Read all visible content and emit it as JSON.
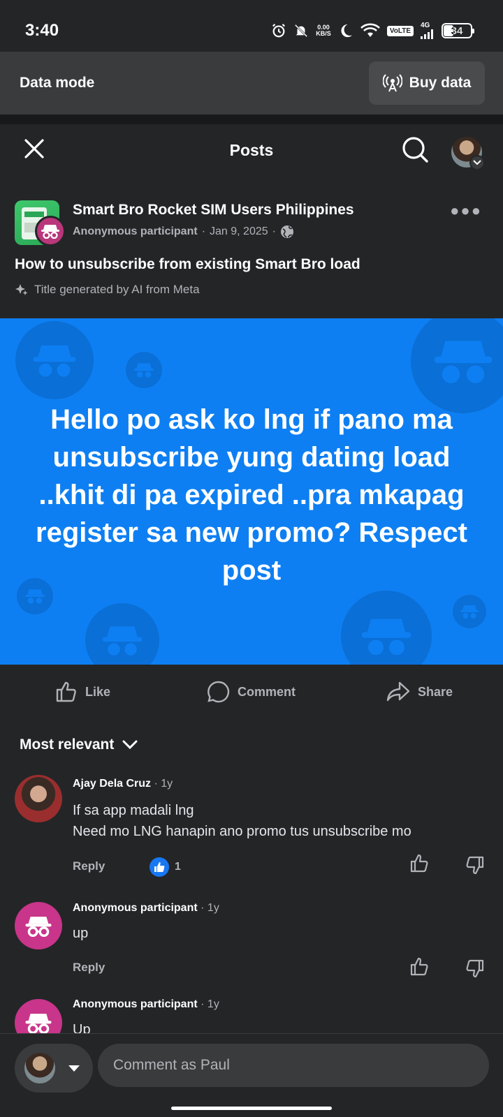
{
  "status_bar": {
    "time": "3:40",
    "net_speed_value": "0.00",
    "net_speed_unit": "KB/S",
    "volte": "VoLTE",
    "signal": "4G",
    "battery": "34",
    "icons": [
      "alarm-icon",
      "mute-icon",
      "moon-icon",
      "wifi-icon",
      "signal-icon"
    ]
  },
  "data_bar": {
    "label": "Data mode",
    "buy_button": "Buy data"
  },
  "header": {
    "title": "Posts"
  },
  "post": {
    "group_name": "Smart Bro Rocket SIM Users Philippines",
    "author": "Anonymous participant",
    "date": "Jan 9, 2025",
    "title": "How to unsubscribe from existing Smart Bro load",
    "ai_note": "Title generated by AI from Meta",
    "body": "Hello po ask ko lng if pano ma unsubscribe yung dating load ..khit di pa expired ..pra mkapag register sa new promo? Respect post",
    "background_color": "#0e7ff2"
  },
  "actions": {
    "like": "Like",
    "comment": "Comment",
    "share": "Share"
  },
  "comments_sort": "Most relevant",
  "comments": [
    {
      "name": "Ajay Dela Cruz",
      "time": "1y",
      "line1": "If sa app madali lng",
      "line2": "Need mo LNG hanapin ano promo tus unsubscribe mo",
      "reply": "Reply",
      "like_count": "1"
    },
    {
      "name": "Anonymous participant",
      "time": "1y",
      "line1": "up",
      "reply": "Reply"
    },
    {
      "name": "Anonymous participant",
      "time": "1y",
      "line1": "Up"
    }
  ],
  "composer": {
    "placeholder": "Comment as Paul"
  },
  "colors": {
    "background": "#242527",
    "accent": "#1877f2",
    "anon_avatar": "#c8358a"
  }
}
